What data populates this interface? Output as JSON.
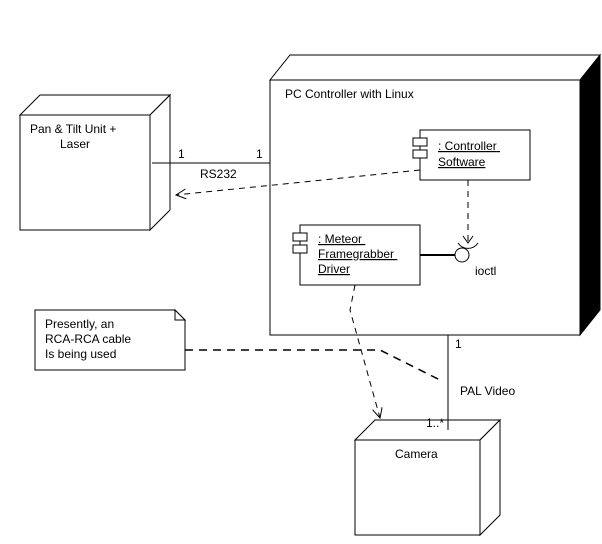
{
  "nodes": {
    "pc": {
      "label": "PC Controller with Linux"
    },
    "pan": {
      "label": "Pan & Tilt Unit +\nLaser"
    },
    "camera": {
      "label": "Camera"
    },
    "ctrl": {
      "label": ": Controller\nSoftware"
    },
    "meteor": {
      "label": ": Meteor\nFramegrabber\nDriver"
    }
  },
  "links": {
    "rs232": {
      "label": "RS232",
      "m1": "1",
      "m2": "1"
    },
    "pal": {
      "label": "PAL Video",
      "m1": "1",
      "m2": "1..*"
    },
    "ioctl": {
      "label": "ioctl"
    }
  },
  "note": {
    "text": "Presently, an\nRCA-RCA cable\nIs being used"
  }
}
